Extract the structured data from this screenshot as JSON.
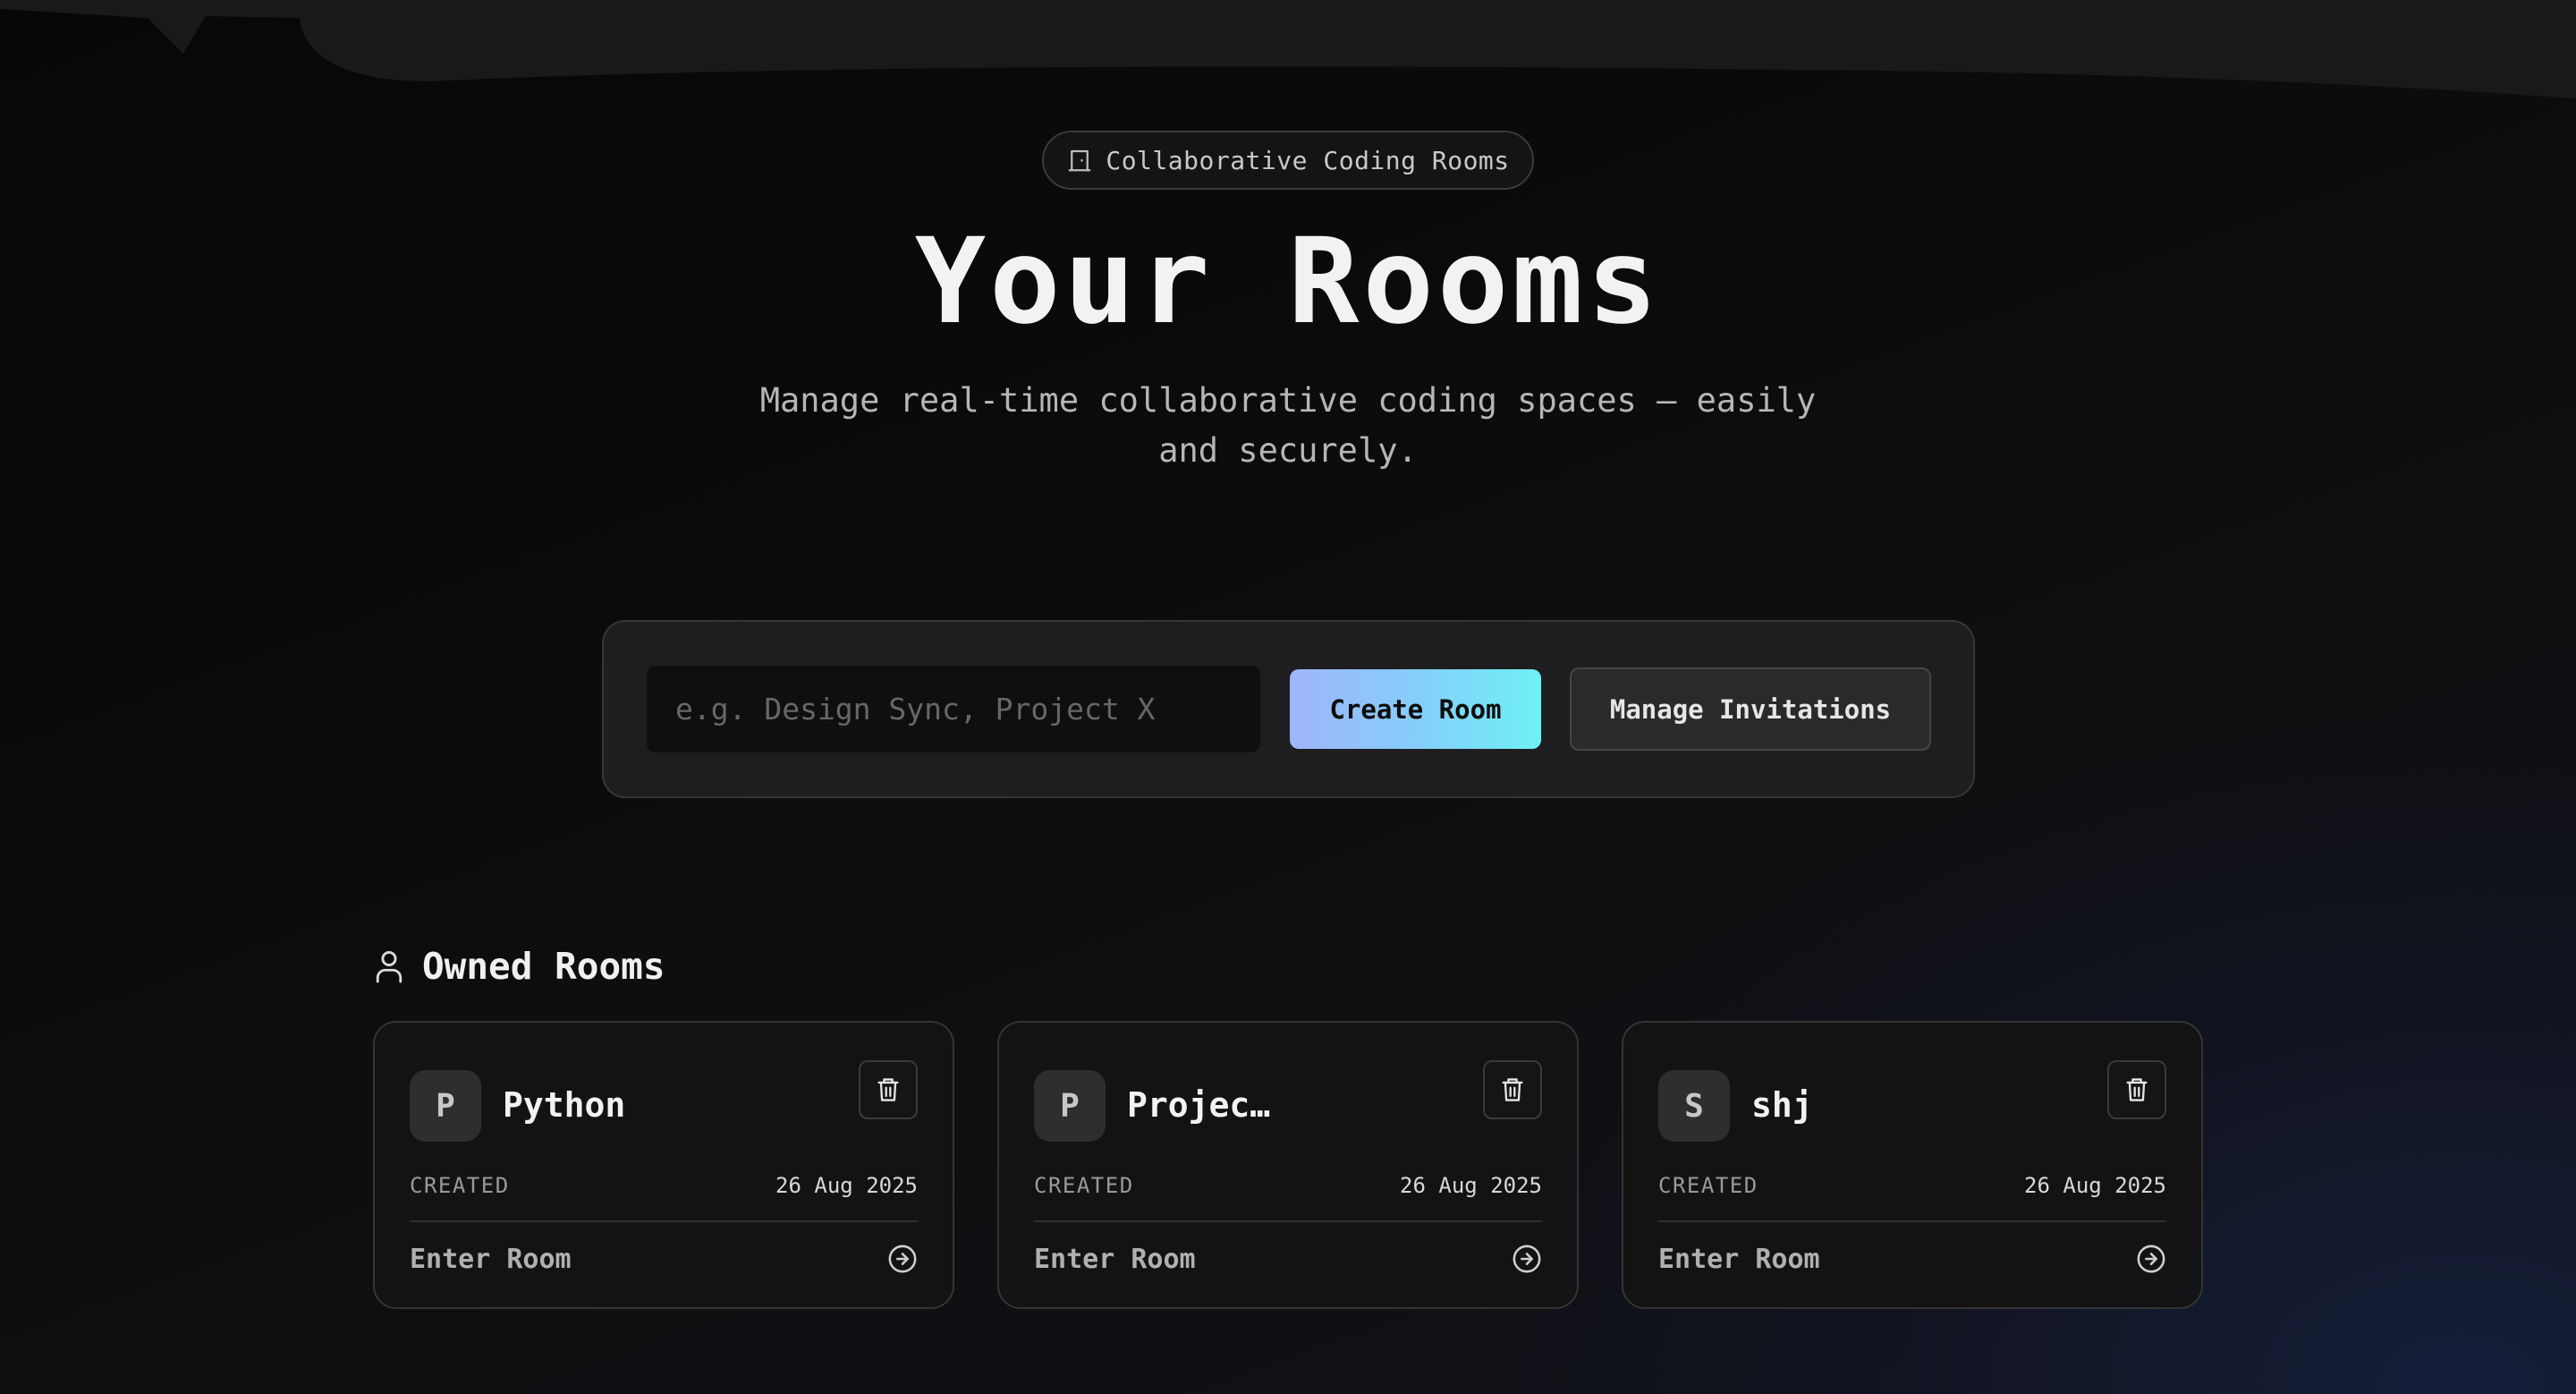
{
  "colors": {
    "accent_gradient_start": "#a0b5fb",
    "accent_gradient_end": "#6ef1f6",
    "background": "#0b0b0c"
  },
  "hero": {
    "badge_icon": "door-icon",
    "badge_text": "Collaborative Coding Rooms",
    "title": "Your Rooms",
    "subtitle": "Manage real-time collaborative coding spaces — easily and securely."
  },
  "create_panel": {
    "input_placeholder": "e.g. Design Sync, Project X",
    "input_value": "",
    "create_button_label": "Create Room",
    "manage_button_label": "Manage Invitations"
  },
  "owned_rooms": {
    "section_icon": "user-icon",
    "section_title": "Owned Rooms",
    "rooms": [
      {
        "initial": "P",
        "name": "Python",
        "created_label": "CREATED",
        "created_date": "26 Aug 2025",
        "enter_label": "Enter Room",
        "delete_icon": "trash-icon",
        "enter_icon": "arrow-right-circle-icon"
      },
      {
        "initial": "P",
        "name": "Projec…",
        "created_label": "CREATED",
        "created_date": "26 Aug 2025",
        "enter_label": "Enter Room",
        "delete_icon": "trash-icon",
        "enter_icon": "arrow-right-circle-icon"
      },
      {
        "initial": "S",
        "name": "shj",
        "created_label": "CREATED",
        "created_date": "26 Aug 2025",
        "enter_label": "Enter Room",
        "delete_icon": "trash-icon",
        "enter_icon": "arrow-right-circle-icon"
      }
    ]
  }
}
